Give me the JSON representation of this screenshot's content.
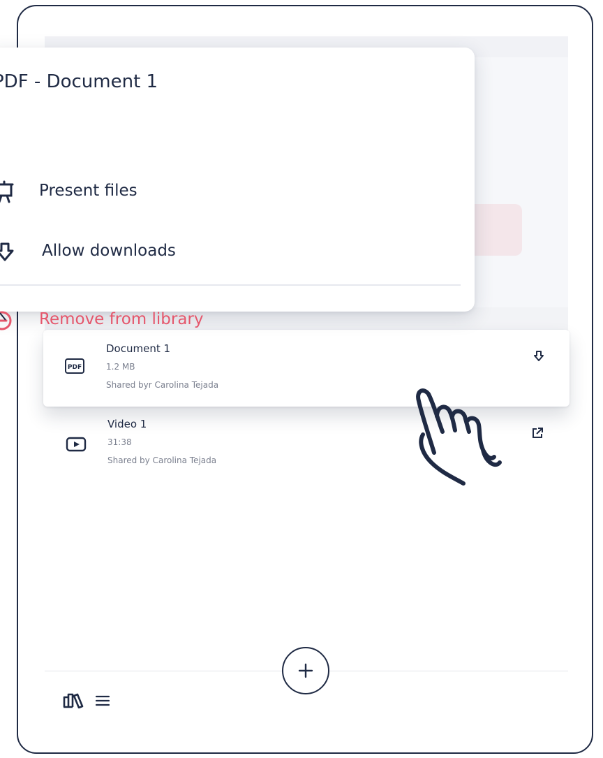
{
  "menu": {
    "title": "PDF - Document 1",
    "items": [
      {
        "label": "Present files",
        "icon": "presentation-board-icon"
      },
      {
        "label": "Allow downloads",
        "icon": "download-arrow-icon"
      },
      {
        "label": "Remove from library",
        "icon": "minus-circle-icon",
        "color": "#e5566b"
      }
    ]
  },
  "files": [
    {
      "name": "Document 1",
      "size": "1.2 MB",
      "shared": "Shared byr Carolina Tejada",
      "type_icon": "pdf-file-icon",
      "action_icon": "download-icon",
      "highlighted": true
    },
    {
      "name": "Video 1",
      "size": "31:38",
      "shared": "Shared by Carolina Tejada",
      "type_icon": "video-play-icon",
      "action_icon": "external-link-icon",
      "highlighted": false
    }
  ],
  "bottom_nav": {
    "add_icon": "plus-icon",
    "library_icon": "library-books-icon",
    "menu_icon": "hamburger-menu-icon"
  },
  "colors": {
    "primary": "#1f2a44",
    "danger": "#e5566b",
    "muted": "#7a7f8e"
  }
}
